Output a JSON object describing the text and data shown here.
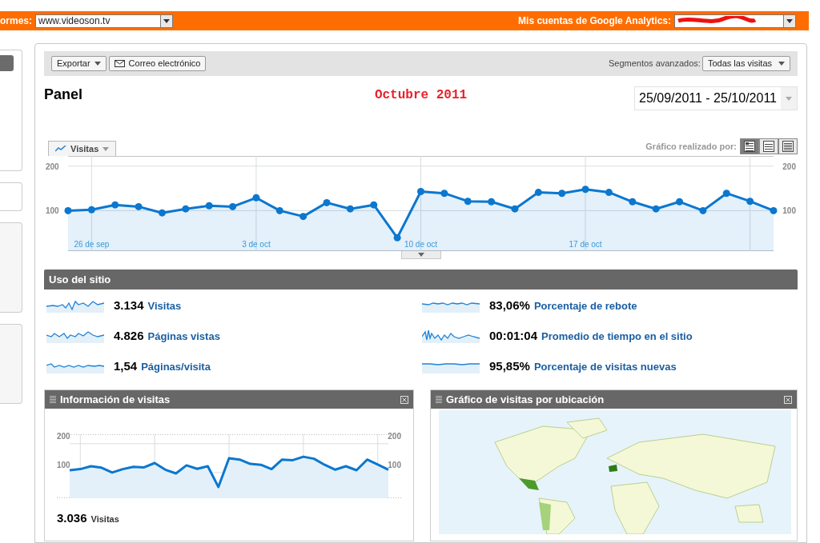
{
  "filter_bar": {
    "site_label": "ormes:",
    "site": "www.videoson.tv",
    "accounts_label": "Mis cuentas de Google Analytics:"
  },
  "toolbar": {
    "buttons": [
      {
        "label": "Exportar",
        "kind": "menu"
      },
      {
        "label": "Correo electrónico",
        "kind": "email"
      }
    ],
    "segments_label": "Segmentos avanzados:",
    "segment": "Todas las visitas"
  },
  "title": "Panel",
  "annotation": "Octubre 2011",
  "date_range": "25/09/2011 - 25/10/2011",
  "main_chart": {
    "view_label": "Gráfico realizado por:",
    "views": [
      {
        "kind": "timeline",
        "selected": true
      },
      {
        "kind": "table",
        "selected": false
      },
      {
        "kind": "list",
        "selected": false
      }
    ],
    "right_axis_labels": [
      "200",
      "100"
    ],
    "chart_data": {
      "type": "area",
      "grid": true,
      "categories": [
        null,
        "26 de sep",
        null,
        null,
        null,
        null,
        null,
        null,
        "3 de oct",
        null,
        null,
        null,
        null,
        null,
        null,
        "10 de oct",
        null,
        null,
        null,
        null,
        null,
        null,
        "17 de oct",
        null,
        null,
        null,
        null,
        null,
        null,
        null,
        null
      ],
      "series": [
        {
          "name": "Visitas",
          "color": "#0b77cf",
          "values": [
            100,
            102,
            113,
            109,
            95,
            104,
            111,
            109,
            129,
            100,
            87,
            118,
            104,
            113,
            39,
            143,
            139,
            121,
            120,
            104,
            141,
            139,
            148,
            141,
            120,
            104,
            120,
            100,
            139,
            121,
            100
          ]
        }
      ],
      "ylim": [
        9,
        223
      ],
      "yticks": [
        100,
        200
      ]
    }
  },
  "site_usage": {
    "title": "Uso del sitio",
    "metrics": [
      {
        "value": "3.134",
        "label": "Visitas"
      },
      {
        "value": "4.826",
        "label": "Páginas vistas"
      },
      {
        "value": "1,54",
        "label": "Páginas/visita"
      },
      {
        "value": "83,06%",
        "label": "Porcentaje de rebote"
      },
      {
        "value": "00:01:04",
        "label": "Promedio de tiempo en el sitio"
      },
      {
        "value": "95,85%",
        "label": "Porcentaje de visitas nuevas"
      }
    ]
  },
  "widgets": [
    {
      "title": "Información de visitas",
      "kind": "chart",
      "total": "3.036",
      "total_label": "Visitas",
      "left_axis_labels": [
        "200",
        "100"
      ],
      "right_axis_labels": [
        "200",
        "100"
      ]
    },
    {
      "title": "Gráfico de visitas por ubicación",
      "kind": "map"
    }
  ]
}
